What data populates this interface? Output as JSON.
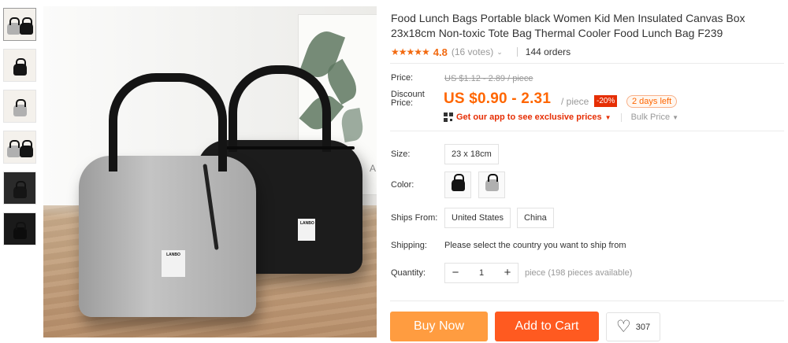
{
  "gallery": {
    "thumbnails": [
      {
        "bag": "grey-black-pair"
      },
      {
        "bag": "black"
      },
      {
        "bag": "grey-open"
      },
      {
        "bag": "grey-black-pair"
      },
      {
        "bag": "black"
      },
      {
        "bag": "black"
      }
    ],
    "main_image": {
      "bag_label_text": "LANBO"
    },
    "poster_letter": "A"
  },
  "product": {
    "title": "Food Lunch Bags Portable black Women Kid Men Insulated Canvas Box 23x18cm Non-toxic Tote Bag Thermal Cooler Food Lunch Bag F239",
    "stars": "★★★★★",
    "rating": "4.8",
    "votes": "(16 votes)",
    "votes_caret": "⌄",
    "orders": "144 orders"
  },
  "price": {
    "price_label": "Price:",
    "original_price": "US $1.12 - 2.89 / piece",
    "discount_label": "Discount Price:",
    "current_price": "US $0.90 - 2.31",
    "per_piece": "/ piece",
    "discount_badge": "-20%",
    "days_left": "2 days left",
    "app_promo": "Get our app to see exclusive prices",
    "app_caret": "▼",
    "bulk_price": "Bulk Price",
    "bulk_caret": "▼"
  },
  "options": {
    "size_label": "Size:",
    "size_value": "23 x 18cm",
    "color_label": "Color:",
    "color_swatches": [
      "black",
      "grey"
    ],
    "ships_from_label": "Ships From:",
    "ships_from_options": [
      "United States",
      "China"
    ],
    "shipping_label": "Shipping:",
    "shipping_text": "Please select the country you want to ship from",
    "quantity_label": "Quantity:",
    "quantity_value": "1",
    "minus": "−",
    "plus": "+",
    "quantity_note": "piece (198 pieces available)"
  },
  "actions": {
    "buy_now": "Buy Now",
    "add_to_cart": "Add to Cart",
    "wishlist_icon": "♡",
    "wishlist_count": "307"
  },
  "colors": {
    "accent_orange": "#f60",
    "buy_now_bg": "#ff9c40",
    "add_to_cart_bg": "#ff5a20",
    "badge_red": "#e62e04",
    "star_color": "#f26a11"
  }
}
